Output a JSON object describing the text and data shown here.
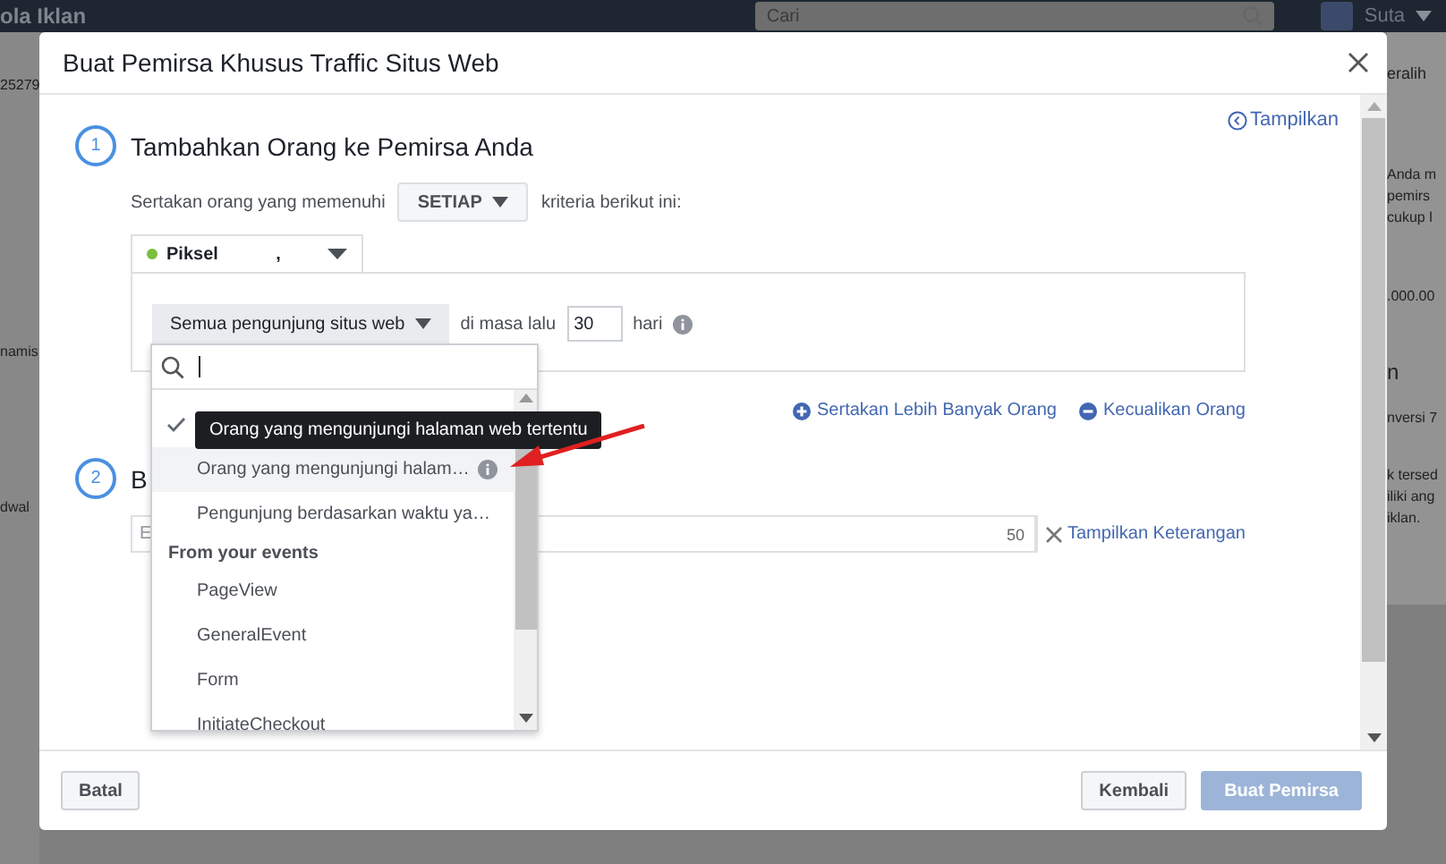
{
  "background": {
    "topbar_title": "ola Iklan",
    "search_placeholder": "Cari",
    "user_name": "Suta",
    "left_fragments": [
      "25279",
      "namis",
      "dwal"
    ],
    "right_fragments": [
      "eralih",
      "Anda m",
      "pemirs",
      "cukup l",
      ".000.00",
      "n",
      "nversi 7",
      "k tersed",
      "iliki ang",
      "iklan."
    ]
  },
  "dialog": {
    "title": "Buat Pemirsa Khusus Traffic Situs Web",
    "step1": {
      "number": "1",
      "title": "Tambahkan Orang ke Pemirsa Anda",
      "show_link": "Tampilkan",
      "include_prefix": "Sertakan orang yang memenuhi",
      "match_select": "SETIAP",
      "include_suffix": "kriteria berikut ini:",
      "source_select": "Piksel",
      "source_suffix": ",",
      "rule": {
        "event_select": "Semua pengunjung situs web",
        "period_prefix": "di masa lalu",
        "days": "30",
        "days_unit": "hari"
      },
      "include_more": "Sertakan Lebih Banyak Orang",
      "exclude": "Kecualikan Orang"
    },
    "dropdown": {
      "tooltip": "Orang yang mengunjungi halaman web tertentu",
      "items": [
        {
          "kind": "option",
          "selected": true,
          "highlighted": false,
          "info": false
        },
        {
          "kind": "option",
          "label": "Orang yang mengunjungi halam…",
          "selected": false,
          "highlighted": true,
          "info": true
        },
        {
          "kind": "option",
          "label": "Pengunjung berdasarkan waktu ya…",
          "selected": false,
          "highlighted": false,
          "info": false
        },
        {
          "kind": "header",
          "label": "From your events"
        },
        {
          "kind": "option",
          "label": "PageView",
          "selected": false,
          "highlighted": false,
          "info": false
        },
        {
          "kind": "option",
          "label": "GeneralEvent",
          "selected": false,
          "highlighted": false,
          "info": false
        },
        {
          "kind": "option",
          "label": "Form",
          "selected": false,
          "highlighted": false,
          "info": false
        },
        {
          "kind": "option",
          "label": "InitiateCheckout",
          "selected": false,
          "highlighted": false,
          "info": false
        }
      ]
    },
    "step2": {
      "number": "2",
      "title": "B",
      "name_placeholder": "E",
      "char_count": "50",
      "description_link": "Tampilkan Keterangan"
    },
    "buttons": {
      "cancel": "Batal",
      "back": "Kembali",
      "create": "Buat Pemirsa",
      "create_disabled": true
    }
  }
}
